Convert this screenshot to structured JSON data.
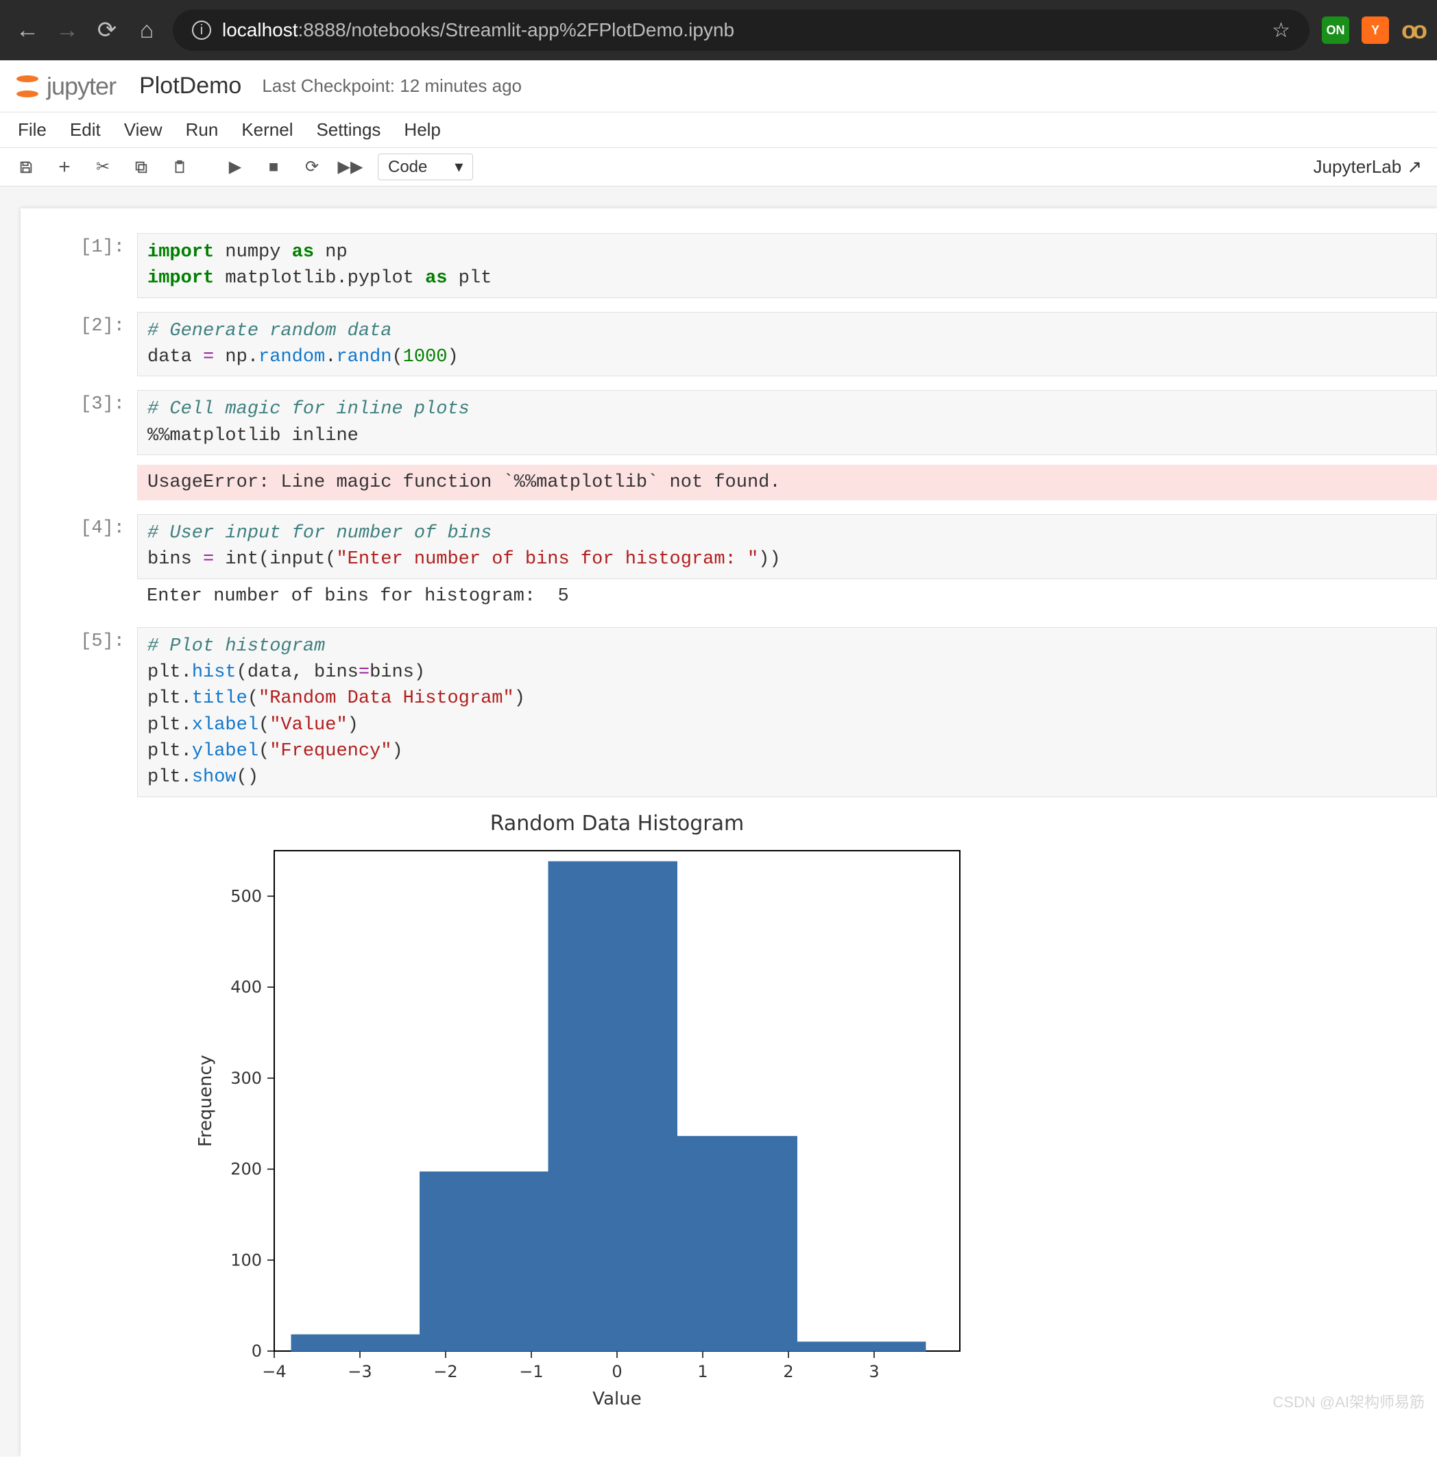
{
  "browser": {
    "url_host": "localhost",
    "url_rest": ":8888/notebooks/Streamlit-app%2FPlotDemo.ipynb",
    "ext_on_label": "ON",
    "ext_y_label": "Y",
    "ext_loop_label": "oo"
  },
  "header": {
    "logo_text": "jupyter",
    "title": "PlotDemo",
    "checkpoint": "Last Checkpoint: 12 minutes ago"
  },
  "menu": {
    "file": "File",
    "edit": "Edit",
    "view": "View",
    "run": "Run",
    "kernel": "Kernel",
    "settings": "Settings",
    "help": "Help"
  },
  "toolbar": {
    "cell_type": "Code",
    "jupyterlab_link": "JupyterLab"
  },
  "cells": {
    "p1": "[1]:",
    "p2": "[2]:",
    "p3": "[3]:",
    "p4": "[4]:",
    "p5": "[5]:",
    "c1": {
      "l1a": "import",
      "l1b": " numpy ",
      "l1c": "as",
      "l1d": " np",
      "l2a": "import",
      "l2b": " matplotlib.pyplot ",
      "l2c": "as",
      "l2d": " plt"
    },
    "c2": {
      "cm": "# Generate random data",
      "l": "data ",
      "op": "=",
      "sp": " np.",
      "fn": "random",
      "dot": ".",
      "fn2": "randn",
      "par": "(",
      "num": "1000",
      "par2": ")"
    },
    "c3": {
      "cm": "# Cell magic for inline plots",
      "l": "%%matplotlib inline"
    },
    "e3": "UsageError: Line magic function `%%matplotlib` not found.",
    "c4": {
      "cm": "# User input for number of bins",
      "a": "bins ",
      "op": "=",
      "b": " int(input(",
      "str": "\"Enter number of bins for histogram: \"",
      "c": "))"
    },
    "o4": "Enter number of bins for histogram:  5",
    "c5": {
      "cm": "# Plot histogram",
      "l2": "plt.",
      "f2": "hist",
      "r2": "(data, bins",
      "op2": "=",
      "r2b": "bins)",
      "l3": "plt.",
      "f3": "title",
      "r3": "(",
      "s3": "\"Random Data Histogram\"",
      "r3b": ")",
      "l4": "plt.",
      "f4": "xlabel",
      "r4": "(",
      "s4": "\"Value\"",
      "r4b": ")",
      "l5": "plt.",
      "f5": "ylabel",
      "r5": "(",
      "s5": "\"Frequency\"",
      "r5b": ")",
      "l6": "plt.",
      "f6": "show",
      "r6": "()"
    }
  },
  "chart_data": {
    "type": "bar",
    "title": "Random Data Histogram",
    "xlabel": "Value",
    "ylabel": "Frequency",
    "xlim": [
      -4,
      4
    ],
    "ylim": [
      0,
      550
    ],
    "xticks": [
      -4,
      -3,
      -2,
      -1,
      0,
      1,
      2,
      3
    ],
    "yticks": [
      0,
      100,
      200,
      300,
      400,
      500
    ],
    "bin_edges": [
      -3.8,
      -2.3,
      -0.8,
      0.7,
      2.1,
      3.6
    ],
    "values": [
      18,
      197,
      538,
      236,
      10
    ]
  },
  "watermark": "CSDN @AI架构师易筋"
}
